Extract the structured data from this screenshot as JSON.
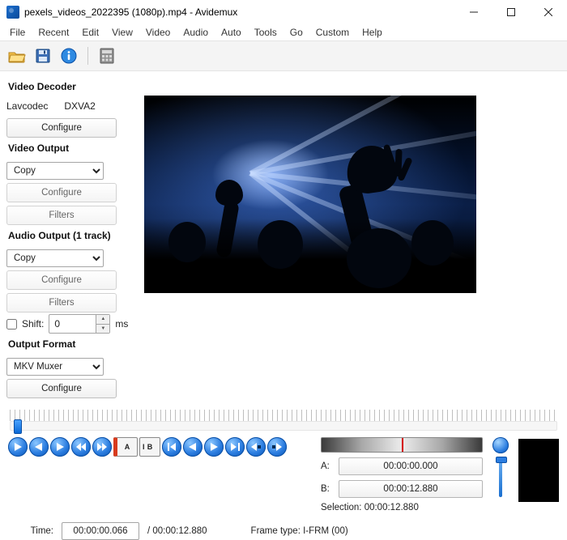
{
  "window": {
    "title": "pexels_videos_2022395 (1080p).mp4 - Avidemux"
  },
  "menu": {
    "items": [
      "File",
      "Recent",
      "Edit",
      "View",
      "Video",
      "Audio",
      "Auto",
      "Tools",
      "Go",
      "Custom",
      "Help"
    ]
  },
  "sidebar": {
    "decoder": {
      "title": "Video Decoder",
      "codec": "Lavcodec",
      "hw": "DXVA2",
      "configure": "Configure"
    },
    "video_output": {
      "title": "Video Output",
      "value": "Copy",
      "configure": "Configure",
      "filters": "Filters"
    },
    "audio_output": {
      "title": "Audio Output (1 track)",
      "value": "Copy",
      "configure": "Configure",
      "filters": "Filters",
      "shift_label": "Shift:",
      "shift_value": "0",
      "shift_unit": "ms"
    },
    "output_format": {
      "title": "Output Format",
      "value": "MKV Muxer",
      "configure": "Configure"
    }
  },
  "time": {
    "label": "Time:",
    "current": "00:00:00.066",
    "total": "/ 00:00:12.880",
    "frame_type": "Frame type:  I-FRM (00)"
  },
  "ab": {
    "a_label": "A:",
    "a_value": "00:00:00.000",
    "b_label": "B:",
    "b_value": "00:00:12.880",
    "selection": "Selection: 00:00:12.880"
  }
}
